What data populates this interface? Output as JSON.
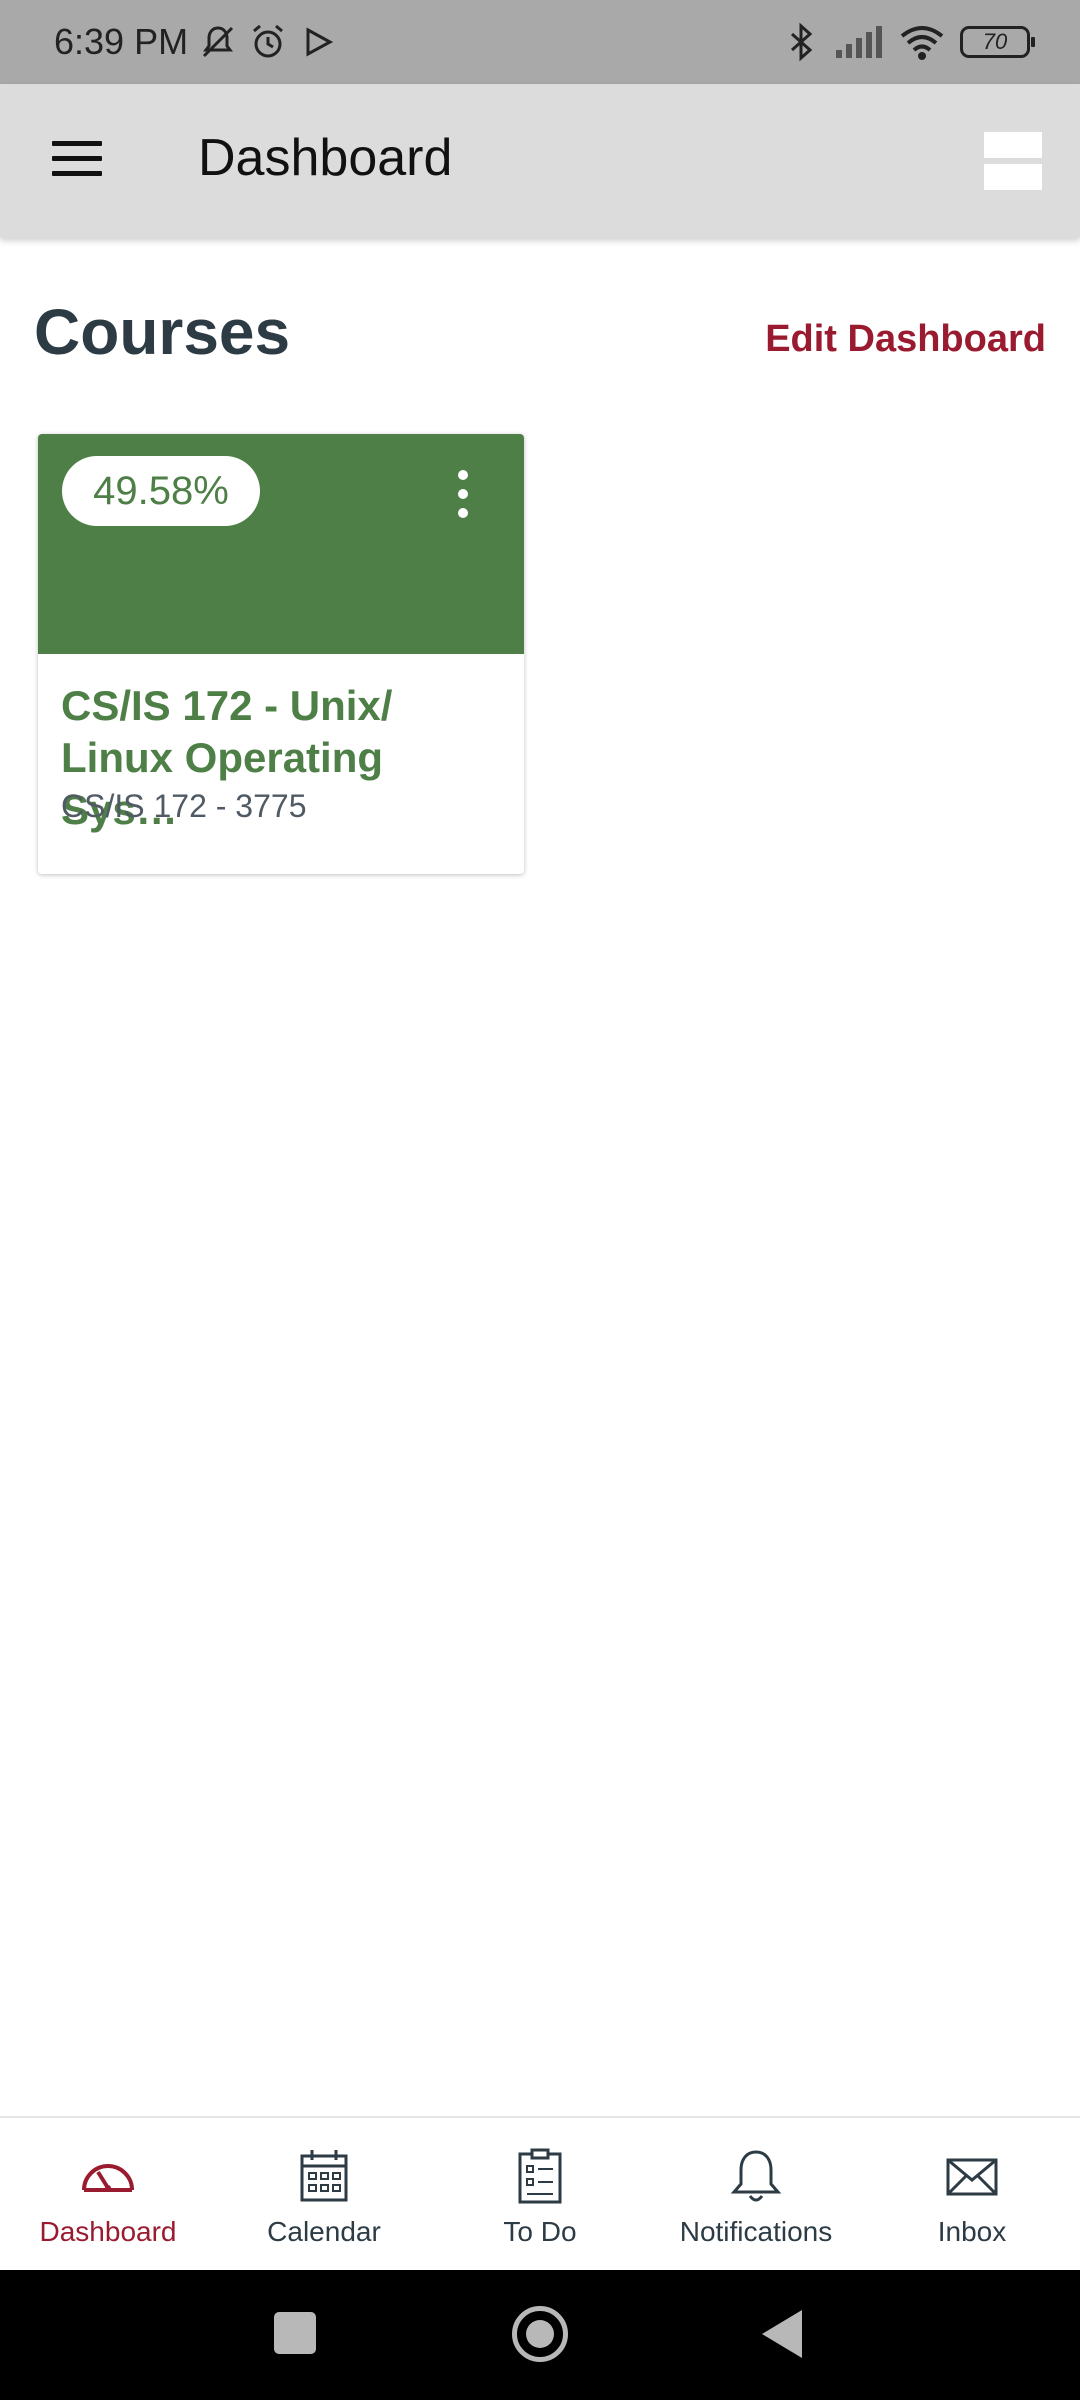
{
  "status_bar": {
    "time": "6:39 PM",
    "battery": "70",
    "icons": [
      "mute-icon",
      "alarm-icon",
      "play-icon",
      "bluetooth-icon",
      "signal-icon",
      "wifi-icon",
      "battery-icon"
    ]
  },
  "app_bar": {
    "title": "Dashboard"
  },
  "main": {
    "heading": "Courses",
    "edit_label": "Edit Dashboard",
    "course": {
      "grade": "49.58%",
      "title": "CS/IS 172 - Unix/ Linux Operating Sys…",
      "code": "CS/IS 172 - 3775",
      "color": "#4d7f46"
    }
  },
  "bottom_nav": {
    "items": [
      {
        "label": "Dashboard",
        "icon": "dashboard-icon"
      },
      {
        "label": "Calendar",
        "icon": "calendar-icon"
      },
      {
        "label": "To Do",
        "icon": "clipboard-icon"
      },
      {
        "label": "Notifications",
        "icon": "bell-icon"
      },
      {
        "label": "Inbox",
        "icon": "mail-icon"
      }
    ],
    "active_color": "#9a1b2f"
  }
}
